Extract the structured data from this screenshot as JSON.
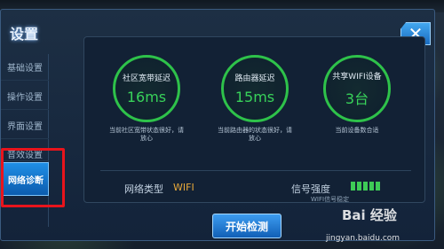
{
  "dialog": {
    "title": "设置",
    "close_symbol": "✕"
  },
  "sidebar": {
    "items": [
      {
        "label": "基础设置"
      },
      {
        "label": "操作设置"
      },
      {
        "label": "界面设置"
      },
      {
        "label": "音效设置"
      },
      {
        "label": "网络诊断",
        "active": true
      }
    ]
  },
  "stats": [
    {
      "label": "社区宽带延迟",
      "value": "16ms",
      "note": "当前社区宽带状态很好，请放心"
    },
    {
      "label": "路由器延迟",
      "value": "15ms",
      "note": "当前路由器的状态很好，请放心"
    },
    {
      "label": "共享WIFI设备",
      "value": "3台",
      "note": "当前设备数合适"
    }
  ],
  "network": {
    "type_label": "网络类型",
    "type_value": "WIFI",
    "signal_label": "信号强度",
    "signal_bars": 5,
    "signal_note": "WIFI信号稳定"
  },
  "actions": {
    "start_label": "开始检测"
  },
  "watermark": {
    "logo": "Bai 经验",
    "url": "jingyan.baidu.com"
  },
  "colors": {
    "ring": "#2ec24a",
    "value": "#38d25a",
    "accent": "#e8a93a",
    "highlight": "#e8141c"
  }
}
